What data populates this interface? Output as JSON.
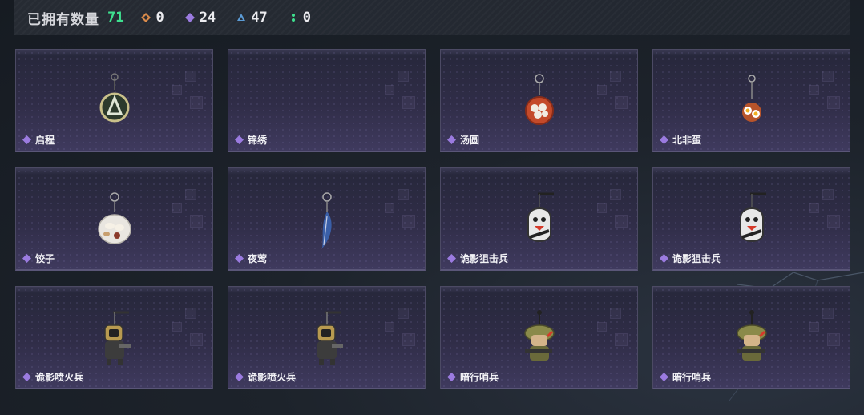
{
  "header": {
    "title": "已拥有数量",
    "total": "71",
    "stats": [
      {
        "icon": "orange-diamond-icon",
        "color": "#d98a4a",
        "value": "0"
      },
      {
        "icon": "purple-gem-icon",
        "color": "#9b7be0",
        "value": "24"
      },
      {
        "icon": "blue-triangle-icon",
        "color": "#5b9bd5",
        "value": "47"
      },
      {
        "icon": "green-dots-icon",
        "color": "#3ee08f",
        "value": "0"
      }
    ]
  },
  "items": [
    {
      "name": "启程",
      "charm": "compass-medal"
    },
    {
      "name": "锦绣",
      "charm": "none"
    },
    {
      "name": "汤圆",
      "charm": "soup-bowl"
    },
    {
      "name": "北非蛋",
      "charm": "egg-plate"
    },
    {
      "name": "饺子",
      "charm": "dumpling-plate"
    },
    {
      "name": "夜莺",
      "charm": "feather"
    },
    {
      "name": "诡影狙击兵",
      "charm": "ghost-sniper"
    },
    {
      "name": "诡影狙击兵",
      "charm": "ghost-sniper"
    },
    {
      "name": "诡影喷火兵",
      "charm": "flame-soldier"
    },
    {
      "name": "诡影喷火兵",
      "charm": "flame-soldier"
    },
    {
      "name": "暗行哨兵",
      "charm": "camo-sentry"
    },
    {
      "name": "暗行哨兵",
      "charm": "camo-sentry"
    }
  ],
  "colors": {
    "accent_green": "#3ee08f",
    "rarity_purple": "#9b7be0",
    "card_border": "#4c4a64"
  }
}
